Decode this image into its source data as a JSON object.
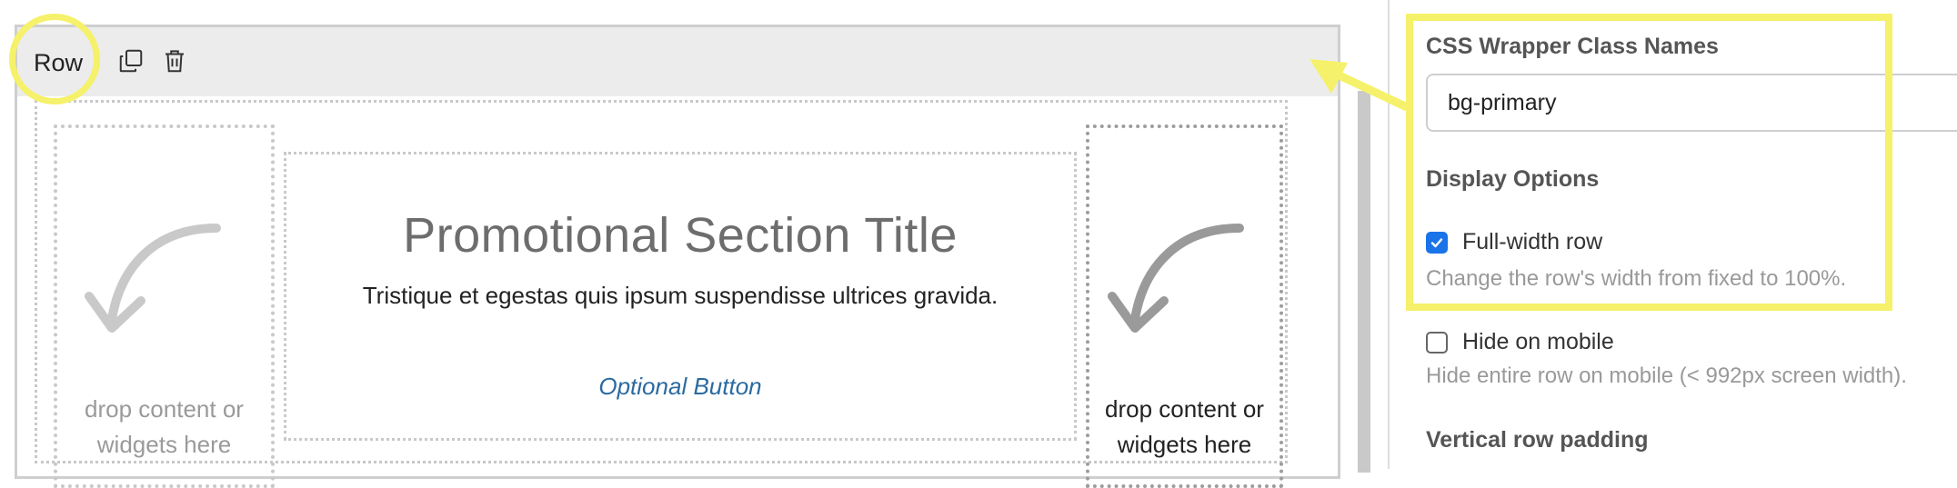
{
  "editor": {
    "row_label": "Row",
    "copy_icon": "copy-icon",
    "delete_icon": "trash-icon",
    "columns": {
      "left_drop_text": "drop content or widgets here",
      "right_drop_text": "drop content or widgets here"
    },
    "promo": {
      "title": "Promotional Section Title",
      "subtitle": "Tristique et egestas quis ipsum suspendisse ultrices gravida.",
      "button": "Optional Button"
    }
  },
  "panel": {
    "css_label": "CSS Wrapper Class Names",
    "css_value": "bg-primary",
    "display_heading": "Display Options",
    "full_width": {
      "label": "Full-width row",
      "checked": true,
      "help": "Change the row's width from fixed to 100%."
    },
    "hide_mobile": {
      "label": "Hide on mobile",
      "checked": false,
      "help": "Hide entire row on mobile (< 992px screen width)."
    },
    "padding_heading": "Vertical row padding"
  },
  "colors": {
    "highlight": "#f5f16a",
    "checkbox_checked": "#1a73e8",
    "link": "#2b6aa0"
  }
}
